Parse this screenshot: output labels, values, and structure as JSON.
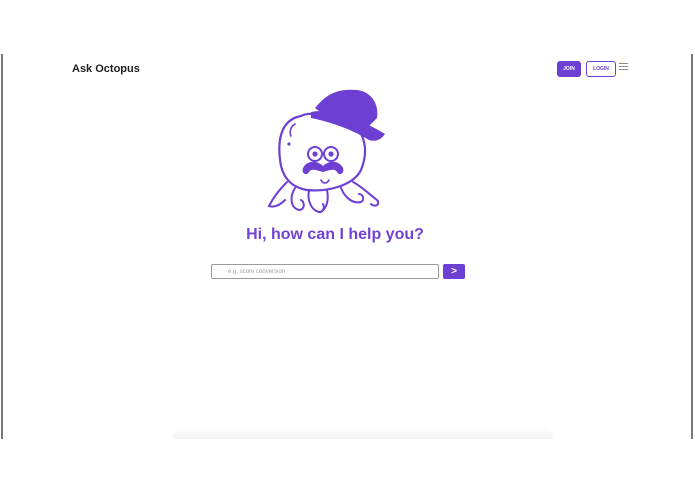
{
  "header": {
    "brand": "Ask Octopus",
    "join_label": "JOIN",
    "login_label": "LOGIN",
    "menu_icon": "hamburger-menu-icon"
  },
  "hero": {
    "mascot": "octopus-with-hat-and-mustache",
    "greeting": "Hi, how can I help you?"
  },
  "search": {
    "placeholder": "e.g. score conversion",
    "value": "",
    "submit_label": ">"
  },
  "colors": {
    "accent": "#6e3fd3",
    "heading": "#7142d6",
    "text": "#1f1f1f"
  }
}
